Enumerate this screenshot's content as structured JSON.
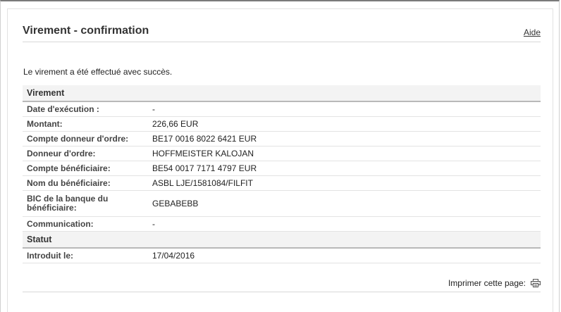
{
  "header": {
    "title": "Virement - confirmation",
    "help_label": "Aide"
  },
  "success_message": "Le virement a été effectué avec succès.",
  "sections": {
    "virement": {
      "title": "Virement",
      "rows": [
        {
          "label": "Date d'exécution :",
          "value": "-"
        },
        {
          "label": "Montant:",
          "value": "226,66 EUR"
        },
        {
          "label": "Compte donneur d'ordre:",
          "value": "BE17 0016 8022 6421 EUR"
        },
        {
          "label": "Donneur d'ordre:",
          "value": "HOFFMEISTER KALOJAN"
        },
        {
          "label": "Compte bénéficiaire:",
          "value": "BE54 0017 7171 4797 EUR"
        },
        {
          "label": "Nom du bénéficiaire:",
          "value": "ASBL LJE/1581084/FILFIT"
        },
        {
          "label": "BIC de la banque du bénéficiaire:",
          "value": "GEBABEBB"
        },
        {
          "label": "Communication:",
          "value": "-"
        }
      ]
    },
    "statut": {
      "title": "Statut",
      "rows": [
        {
          "label": "Introduit le:",
          "value": "17/04/2016"
        }
      ]
    }
  },
  "footer": {
    "print_label": "Imprimer cette page:",
    "print_icon": "printer-icon"
  }
}
